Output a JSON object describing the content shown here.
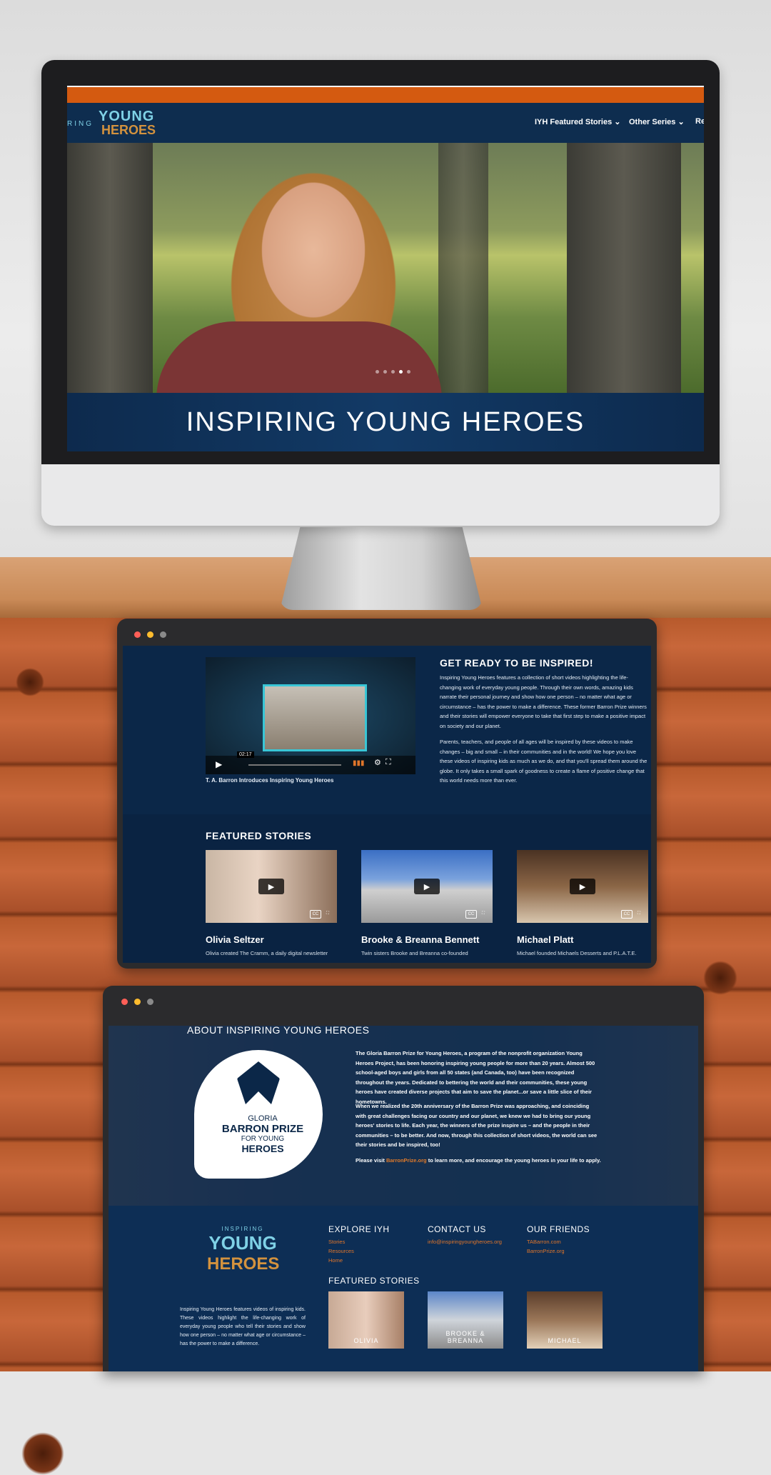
{
  "site": {
    "logo": {
      "ring_text": "RING",
      "young": "YOUNG",
      "heroes": "HEROES"
    },
    "nav": [
      {
        "label": "IYH Featured Stories ⌄"
      },
      {
        "label": "Other Series ⌄"
      },
      {
        "label": "Re"
      }
    ],
    "banner_title": "INSPIRING YOUNG HEROES",
    "slider_dots": 5,
    "slider_active": 4
  },
  "colors": {
    "accent": "#d45a10",
    "navy": "#0b2748",
    "link": "#e07a2a"
  },
  "intro": {
    "heading": "GET READY TO BE INSPIRED!",
    "para1": "Inspiring Young Heroes features a collection of short videos highlighting the life-changing work of everyday young people. Through their own words, amazing kids narrate their personal journey and show how one person – no matter what age or circumstance – has the power to make a difference. These former Barron Prize winners and their stories will empower everyone to take that first step to make a positive impact on society and our planet.",
    "para2": "Parents, teachers, and people of all ages will be inspired by these videos to make changes – big and small – in their communities and in the world! We hope you love these videos of inspiring kids as much as we do, and that you'll spread them around the globe. It only takes a small spark of goodness to create a flame of positive change that this world needs more than ever.",
    "video_caption": "T. A. Barron Introduces Inspiring Young Heroes",
    "video_time": "02:17"
  },
  "featured": {
    "heading": "FEATURED STORIES",
    "stories": [
      {
        "name": "Olivia Seltzer",
        "desc": "Olivia created The Cramm, a daily digital newsletter"
      },
      {
        "name": "Brooke & Breanna Bennett",
        "desc": "Twin sisters Brooke and Breanna co-founded"
      },
      {
        "name": "Michael Platt",
        "desc": "Michael founded Michaels Desserts and P.L.A.T.E."
      }
    ]
  },
  "about": {
    "heading": "ABOUT INSPIRING YOUNG HEROES",
    "logo_lines": [
      "GLORIA",
      "BARRON PRIZE",
      "FOR YOUNG",
      "HEROES"
    ],
    "para1": "The Gloria Barron Prize for Young Heroes, a program of the nonprofit organization Young Heroes Project, has been honoring inspiring young people for more than 20 years. Almost 500 school-aged boys and girls from all 50 states (and Canada, too) have been recognized throughout the years. Dedicated to bettering the world and their communities, these young heroes have created diverse projects that aim to save the planet...or save a little slice of their hometowns.",
    "para2": "When we realized the 20th anniversary of the Barron Prize was approaching, and coinciding with great challenges facing our country and our planet, we knew we had to bring our young heroes' stories to life. Each year, the winners of the prize inspire us – and the people in their communities – to be better. And now, through this collection of short videos, the world can see their stories and be inspired, too!",
    "para3_before": "Please visit ",
    "para3_link": "BarronPrize.org",
    "para3_after": " to learn more, and encourage the young heroes in your life to apply."
  },
  "footer": {
    "logo": {
      "top": "INSPIRING",
      "young": "YOUNG",
      "heroes": "HEROES"
    },
    "blurb": "Inspiring Young Heroes features videos of inspiring kids. These videos highlight the life-changing work of everyday young people who tell their stories and show how one person – no matter what age or circumstance – has the power to make a difference.",
    "explore": {
      "heading": "EXPLORE IYH",
      "links": [
        "Stories",
        "Resources",
        "Home"
      ]
    },
    "contact": {
      "heading": "CONTACT US",
      "email": "info@inspiringyoungheroes.org"
    },
    "friends": {
      "heading": "OUR FRIENDS",
      "links": [
        "TABarron.com",
        "BarronPrize.org"
      ]
    },
    "featured_heading": "FEATURED STORIES",
    "thumbs": [
      "OLIVIA",
      "BROOKE & BREANNA",
      "MICHAEL"
    ]
  }
}
